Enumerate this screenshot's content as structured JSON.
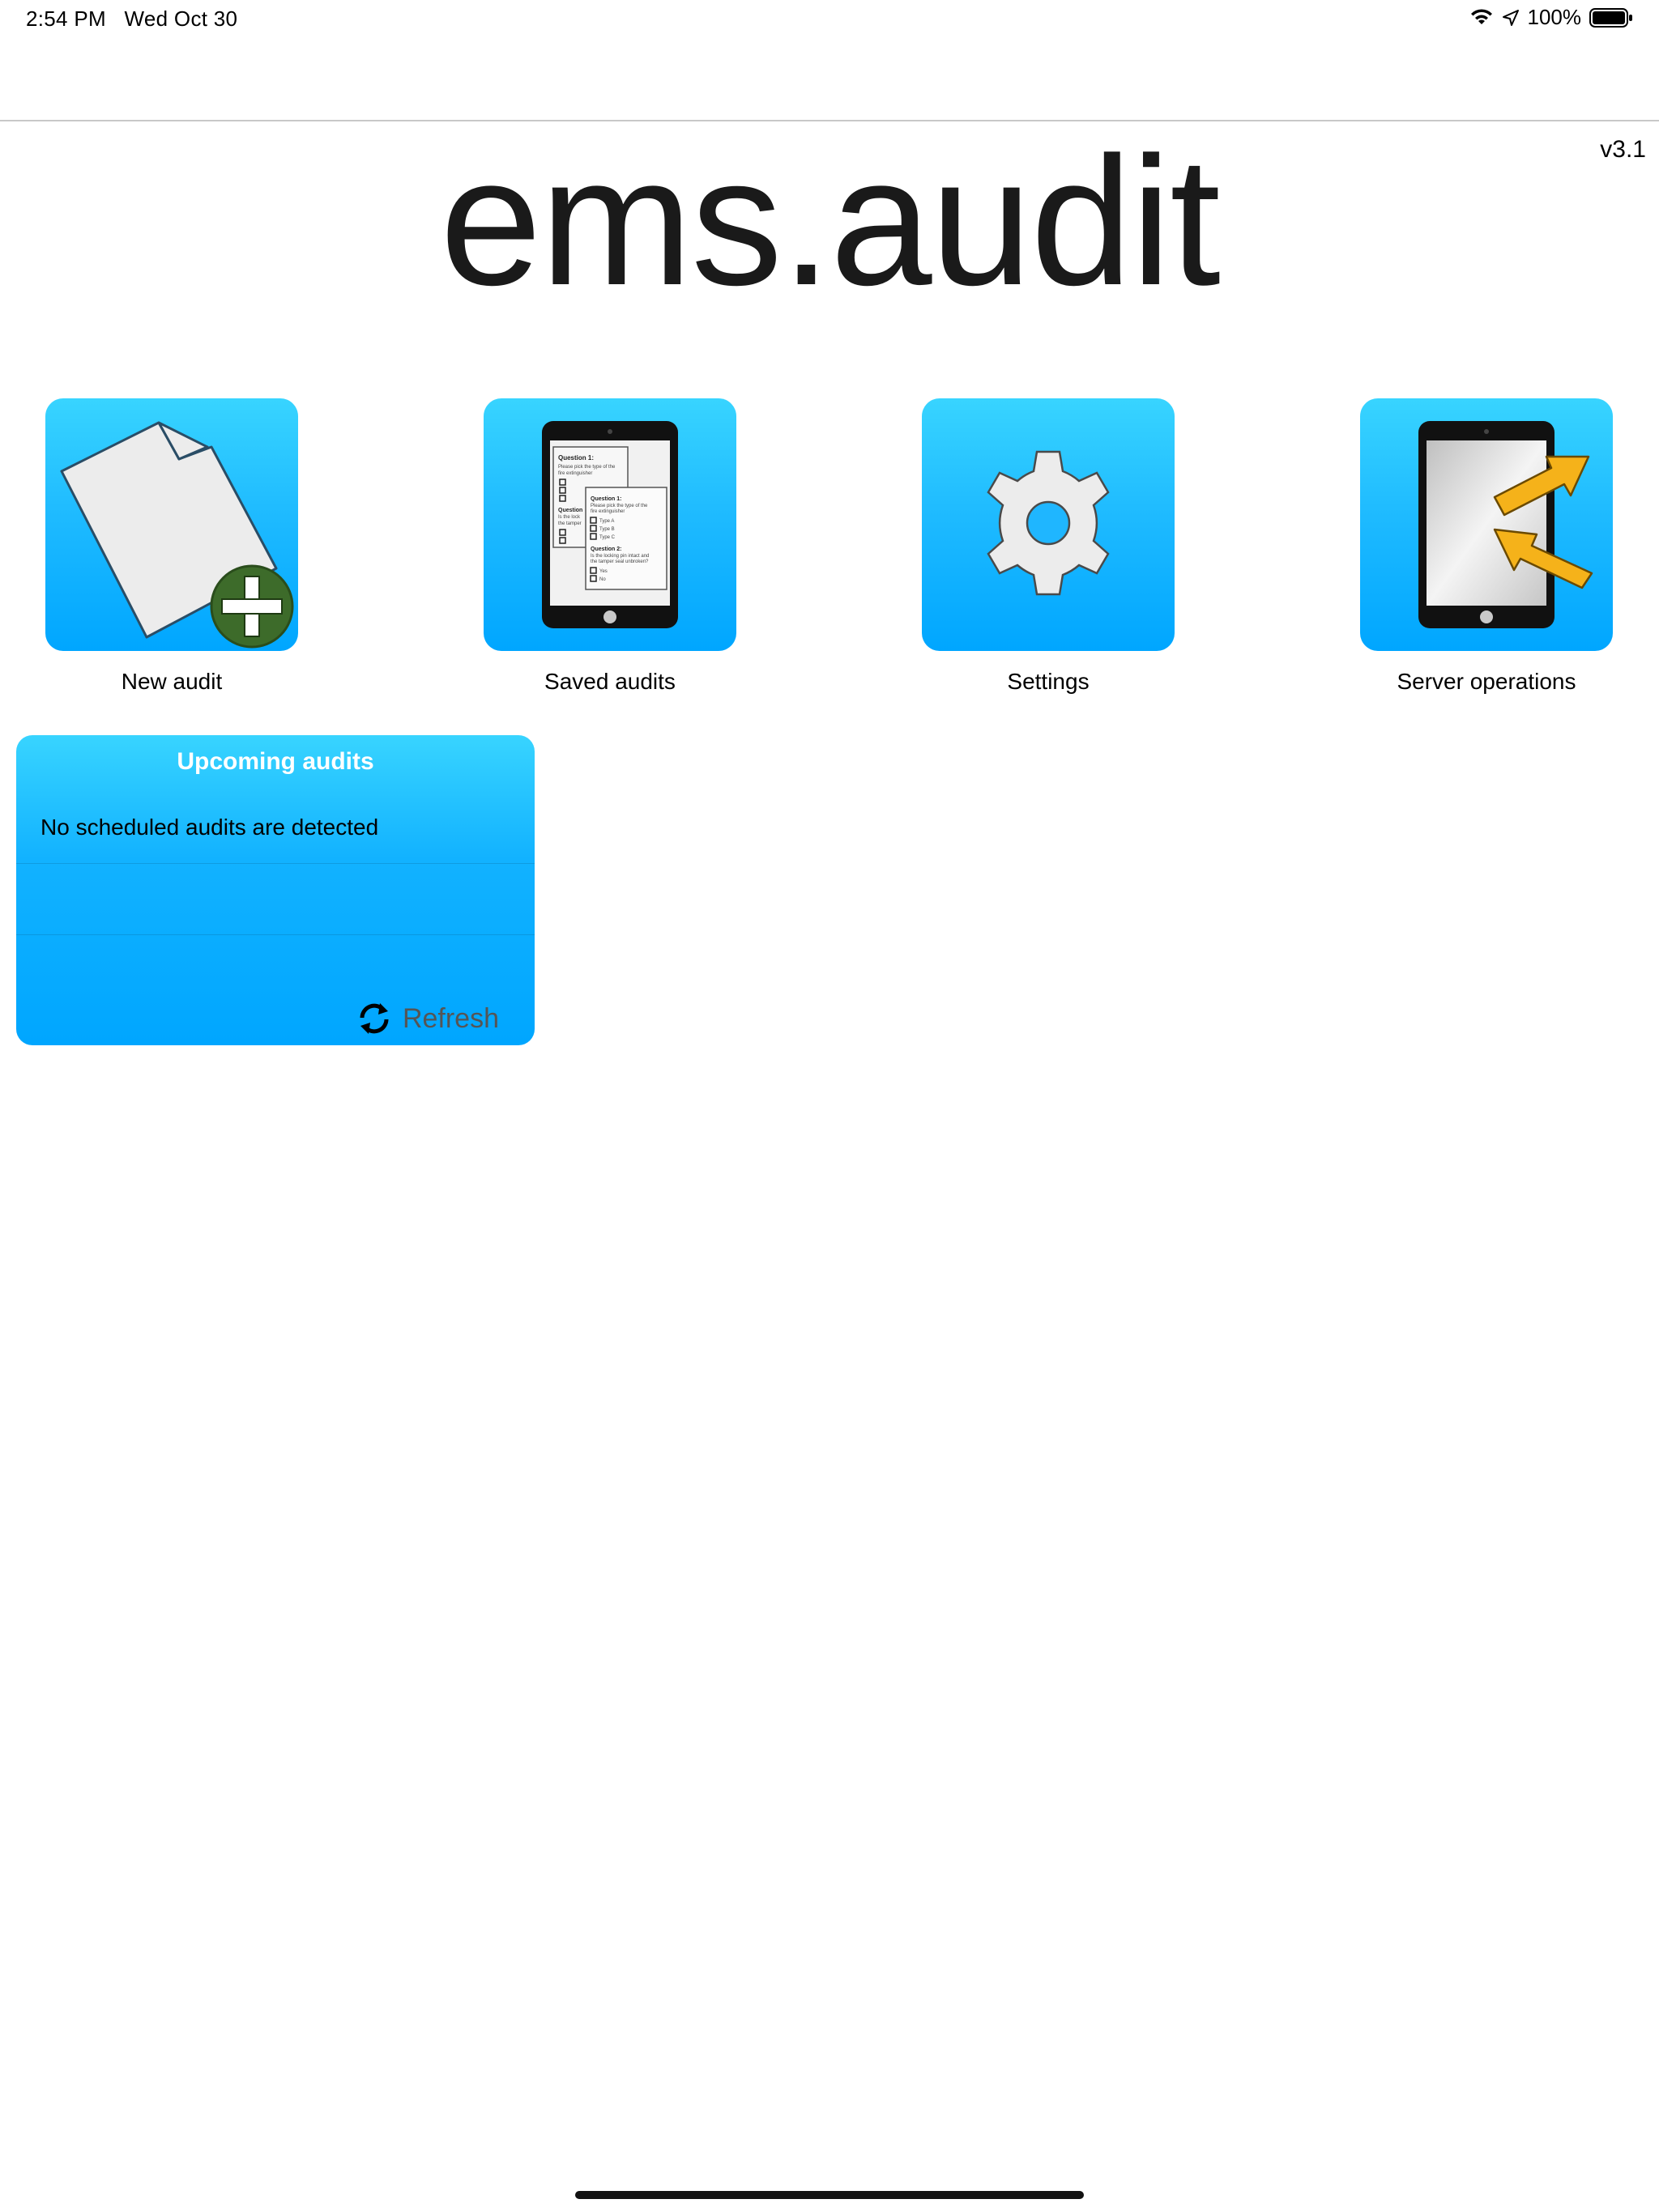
{
  "status_bar": {
    "time": "2:54 PM",
    "date": "Wed Oct 30",
    "battery": "100%"
  },
  "header": {
    "version": "v3.1",
    "title": "ems.audit"
  },
  "tiles": [
    {
      "label": "New audit",
      "icon": "new-audit-icon"
    },
    {
      "label": "Saved audits",
      "icon": "tablet-checklist-icon"
    },
    {
      "label": "Settings",
      "icon": "gear-icon"
    },
    {
      "label": "Server operations",
      "icon": "tablet-sync-arrows-icon"
    }
  ],
  "tablet_form": {
    "q1_title": "Question 1:",
    "q1_text_1": "Please pick the type of the",
    "q1_text_2": "fire extinguisher",
    "opt_a": "Type A",
    "opt_b": "Type B",
    "opt_c": "Type C",
    "q2_title": "Question 2:",
    "q2_text_1": "Is the locking pin intact and",
    "q2_text_2": "the tamper seal unbroken?",
    "opt_yes": "Yes",
    "opt_no": "No",
    "back_q2_title": "Question",
    "back_q2_text_1": "Is the lock",
    "back_q2_text_2": "the tamper"
  },
  "upcoming": {
    "title": "Upcoming audits",
    "empty_message": "No scheduled audits are detected",
    "refresh_label": "Refresh"
  },
  "colors": {
    "tile_top": "#38d4ff",
    "tile_bottom": "#00a6ff",
    "plus_badge": "#3d6b2a",
    "arrow": "#f5b21a"
  }
}
